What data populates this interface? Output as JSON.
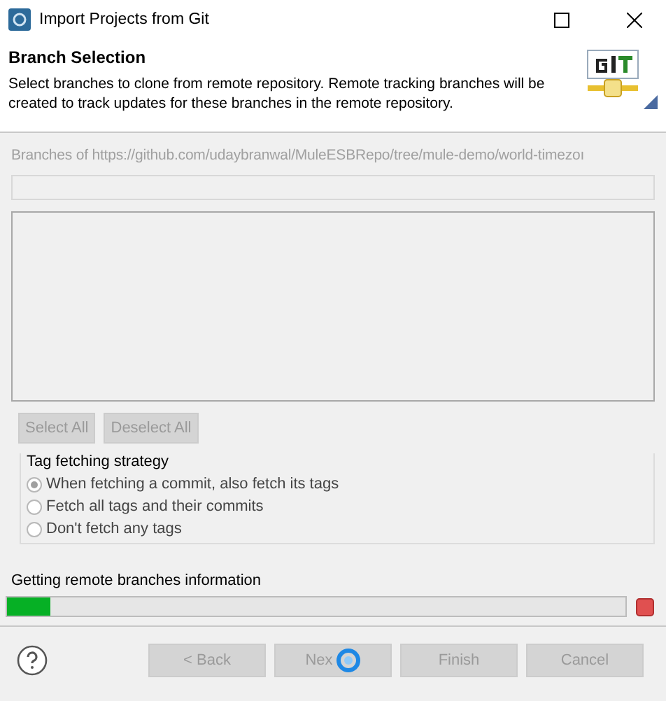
{
  "window": {
    "title": "Import Projects from Git"
  },
  "header": {
    "title": "Branch Selection",
    "description": "Select branches to clone from remote repository. Remote tracking branches will be created to track updates for these branches in the remote repository."
  },
  "branches": {
    "label": "Branches of https://github.com/udaybranwal/MuleESBRepo/tree/mule-demo/world-timezoı",
    "disabled": true
  },
  "list_buttons": [
    {
      "label": "Select All",
      "disabled": true
    },
    {
      "label": "Deselect All",
      "disabled": true
    }
  ],
  "tag_strategy": {
    "title": "Tag fetching strategy",
    "options": [
      {
        "label": "When fetching a commit, also fetch its tags",
        "selected": true,
        "disabled": true
      },
      {
        "label": "Fetch all tags and their commits",
        "selected": false,
        "disabled": true
      },
      {
        "label": "Don't fetch any tags",
        "selected": false,
        "disabled": true
      }
    ]
  },
  "progress": {
    "label": "Getting remote branches information",
    "level": 0.07
  },
  "buttons": [
    {
      "label": "< Back",
      "disabled": true
    },
    {
      "label": "Nex",
      "disabled": true
    },
    {
      "label": "Finish",
      "disabled": true
    },
    {
      "label": "Cancel",
      "disabled": true
    }
  ]
}
